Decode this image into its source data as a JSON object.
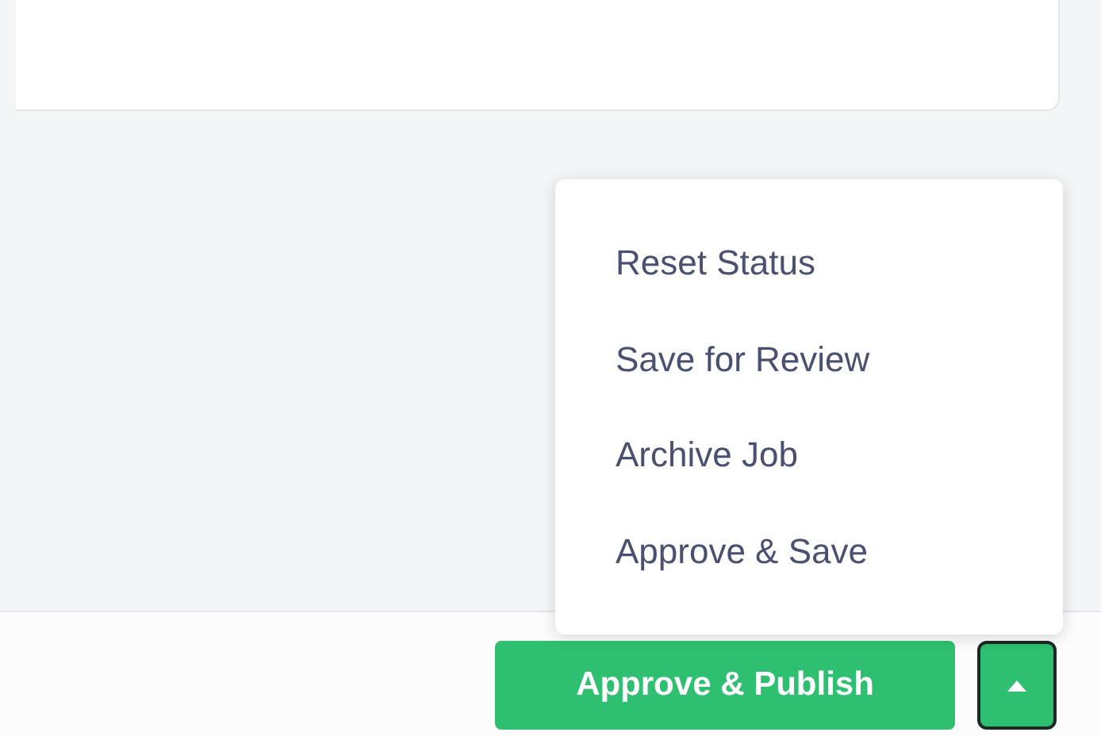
{
  "menu": {
    "items": [
      {
        "label": "Reset Status"
      },
      {
        "label": "Save for Review"
      },
      {
        "label": "Archive Job"
      },
      {
        "label": "Approve & Save"
      }
    ]
  },
  "footer": {
    "primary_button": "Approve & Publish",
    "menu_open": true
  }
}
